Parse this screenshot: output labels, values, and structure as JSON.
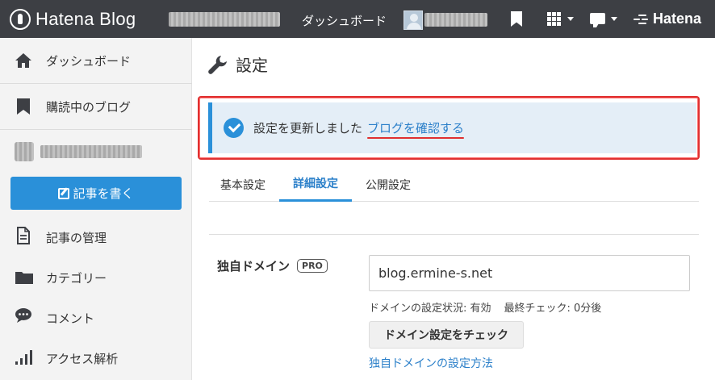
{
  "header": {
    "logo_text": "Hatena Blog",
    "dashboard_label": "ダッシュボード",
    "brand": "Hatena"
  },
  "sidebar": {
    "items": [
      {
        "label": "ダッシュボード",
        "icon": "home-icon"
      },
      {
        "label": "購読中のブログ",
        "icon": "bookmark-icon"
      },
      {
        "label": "記事の管理",
        "icon": "document-icon"
      },
      {
        "label": "カテゴリー",
        "icon": "folder-icon"
      },
      {
        "label": "コメント",
        "icon": "comment-icon"
      },
      {
        "label": "アクセス解析",
        "icon": "bar-chart-icon"
      }
    ],
    "write_button": "記事を書く"
  },
  "main": {
    "page_title": "設定",
    "notice": {
      "message": "設定を更新しました",
      "link": "ブログを確認する"
    },
    "tabs": [
      {
        "label": "基本設定",
        "active": false
      },
      {
        "label": "詳細設定",
        "active": true
      },
      {
        "label": "公開設定",
        "active": false
      }
    ],
    "custom_domain": {
      "label": "独自ドメイン",
      "badge": "PRO",
      "value": "blog.ermine-s.net",
      "status": "ドメインの設定状況: 有効",
      "last_check": "最終チェック: 0分後",
      "check_button": "ドメイン設定をチェック",
      "howto_link": "独自ドメインの設定方法"
    }
  },
  "colors": {
    "accent": "#2a90d9",
    "topbar": "#3d3f44",
    "highlight": "#e03030"
  }
}
